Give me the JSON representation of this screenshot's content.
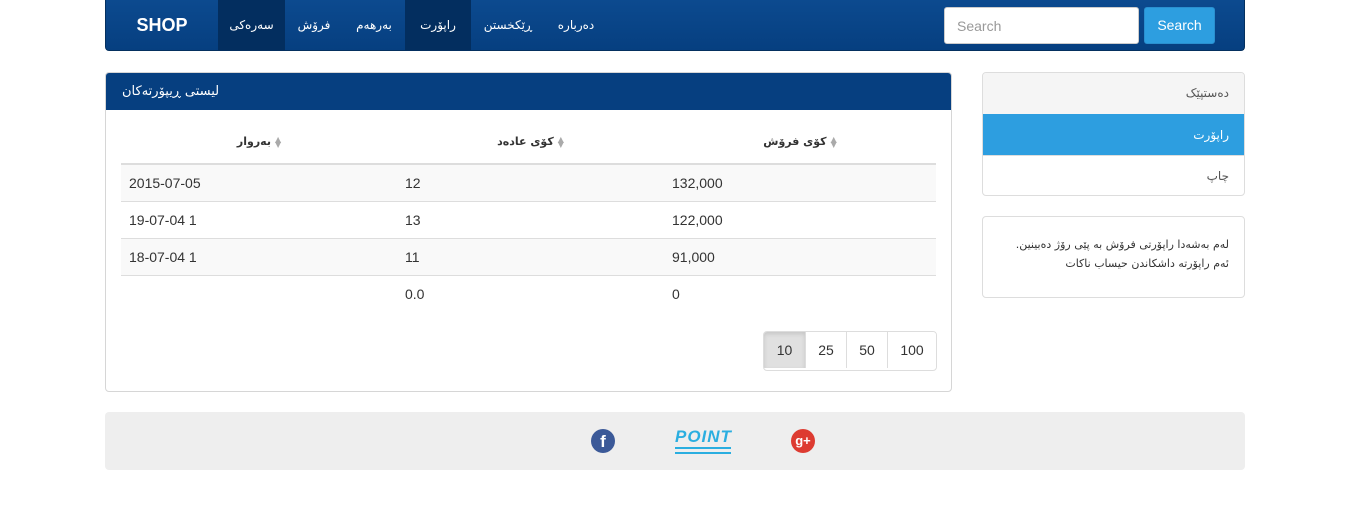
{
  "nav": {
    "brand": "SHOP",
    "items": [
      {
        "label": "سەرەکی",
        "active": true
      },
      {
        "label": "فرۆش",
        "active": false
      },
      {
        "label": "بەرهەم",
        "active": false
      },
      {
        "label": "راپۆرت",
        "active": true
      },
      {
        "label": "ڕێکخستن",
        "active": false
      },
      {
        "label": "دەربارە",
        "active": false
      }
    ],
    "search_placeholder": "Search",
    "search_button": "Search"
  },
  "panel": {
    "title": "لیستی ڕیپۆرتەکان",
    "columns": [
      "بەروار",
      "کۆی عادەد",
      "کۆی فرۆش"
    ],
    "rows": [
      [
        "2015-07-05",
        "12",
        "132,000"
      ],
      [
        "19-07-04 1",
        "13",
        "122,000"
      ],
      [
        "18-07-04 1",
        "11",
        "91,000"
      ],
      [
        "",
        "0.0",
        "0"
      ]
    ],
    "page_sizes": [
      "10",
      "25",
      "50",
      "100"
    ],
    "selected_page_size": "10"
  },
  "sidebar": {
    "menu": [
      {
        "label": "دەستپێک",
        "active": false
      },
      {
        "label": "راپۆرت",
        "active": true
      },
      {
        "label": "چاپ",
        "active": false
      }
    ],
    "info_lines": [
      "لەم بەشەدا راپۆرتی فرۆش بە پێی رۆژ دەبینین.",
      "ئەم راپۆرتە داشکاندن حیساب ناکات"
    ]
  },
  "footer": {
    "icons": [
      "facebook-icon",
      "point-logo",
      "google-plus-icon"
    ],
    "logo_text": "POINT",
    "colors": {
      "facebook": "#3b5998",
      "google_plus": "#dd3b31",
      "logo": "#2aaee0"
    }
  },
  "colors": {
    "navbar": "#063f80",
    "accent": "#2d9ee0"
  }
}
